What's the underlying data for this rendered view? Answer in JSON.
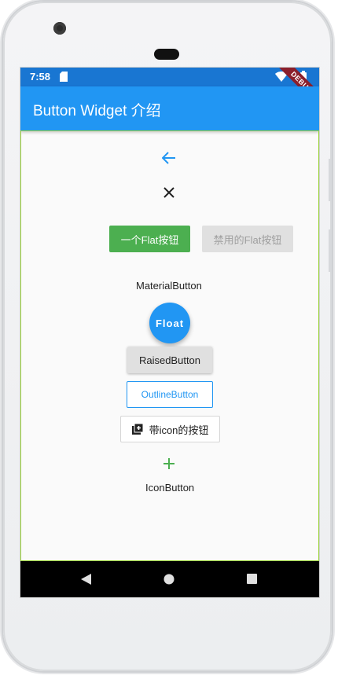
{
  "status_bar": {
    "time": "7:58",
    "debug_banner": "DEBUG"
  },
  "app_bar": {
    "title": "Button Widget 介绍"
  },
  "buttons": {
    "back_icon": "arrow-left-icon",
    "close_icon": "close-icon",
    "flat_button_label": "一个Flat按钮",
    "disabled_flat_button_label": "禁用的Flat按钮",
    "material_button_label": "MaterialButton",
    "float_button_label": "Float",
    "raised_button_label": "RaisedButton",
    "outline_button_label": "OutlineButton",
    "icon_button_label": "带icon的按钮",
    "plus_icon": "add-icon",
    "icon_button_text": "IconButton"
  },
  "colors": {
    "primary": "#2196f3",
    "status_bar": "#1976d2",
    "flat_button_bg": "#4caf50",
    "disabled_bg": "#e0e0e0",
    "disabled_text": "#9e9e9e",
    "plus_icon": "#4caf50"
  }
}
